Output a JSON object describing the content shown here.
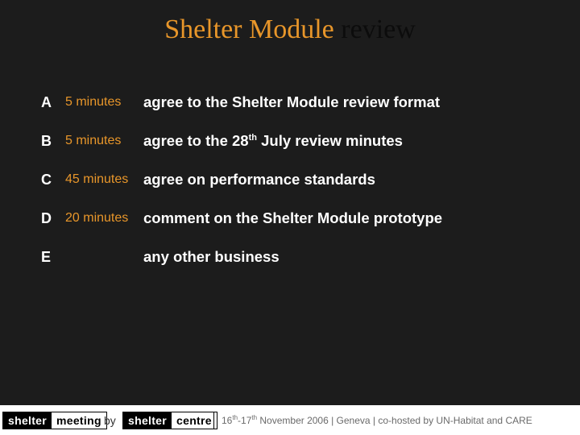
{
  "slide": {
    "title_highlight": "Shelter Module",
    "title_rest": "review"
  },
  "agenda": [
    {
      "letter": "A",
      "duration": "5 minutes",
      "item": "agree to the Shelter Module review format"
    },
    {
      "letter": "B",
      "duration": "5 minutes",
      "item_pre": "agree to the 28",
      "item_sup": "th",
      "item_post": " July review minutes"
    },
    {
      "letter": "C",
      "duration": "45 minutes",
      "item": "agree on performance standards"
    },
    {
      "letter": "D",
      "duration": "20 minutes",
      "item": "comment on the Shelter Module prototype"
    },
    {
      "letter": "E",
      "duration": "",
      "item": "any other business"
    }
  ],
  "footer": {
    "logo1": {
      "dark": "shelter",
      "light": "meeting"
    },
    "by": "by",
    "logo2": {
      "dark": "shelter",
      "light": "centre"
    },
    "date_day1": "16",
    "date_sup1": "th",
    "date_dash": "-17",
    "date_sup2": "th",
    "date_rest": " November  2006  |  Geneva   |  co-hosted by UN-Habitat and CARE"
  },
  "colors": {
    "background": "#1c1c1c",
    "accent": "#e8962a",
    "text": "#ffffff"
  }
}
